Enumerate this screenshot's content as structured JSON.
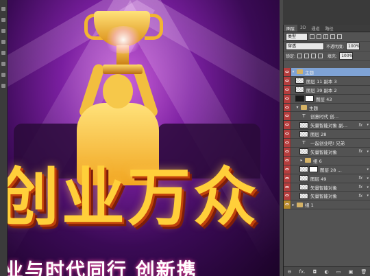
{
  "canvas": {
    "headline": "创业万众",
    "subline": "业与时代同行 创新携"
  },
  "panel": {
    "tabs": [
      "图层",
      "3D",
      "通道",
      "路径"
    ],
    "active_tab": "图层",
    "filter_label": "类型",
    "blend_mode": "穿透",
    "opacity_label": "不透明度:",
    "opacity_value": "100%",
    "lock_label": "锁定:",
    "fill_label": "填充:",
    "fill_value": "100%",
    "layers": [
      {
        "name": "主题",
        "kind": "group-open",
        "selected": true
      },
      {
        "name": "图层 11 副本 3",
        "kind": "layer"
      },
      {
        "name": "图层 39 副本 2",
        "kind": "layer"
      },
      {
        "name": "图层 43",
        "kind": "layer-mask"
      },
      {
        "name": "主题",
        "kind": "group-open-sub"
      },
      {
        "name": "创意时代 创…",
        "kind": "text"
      },
      {
        "name": "矢量智能对象 副…",
        "kind": "smart",
        "fx": "fx"
      },
      {
        "name": "图层 28",
        "kind": "layer"
      },
      {
        "name": "一起创业吧! 兄弟",
        "kind": "text"
      },
      {
        "name": "矢量智能对象",
        "kind": "smart",
        "fx": "fx"
      },
      {
        "name": "组 6",
        "kind": "group-closed"
      },
      {
        "name": "图层 28 …",
        "kind": "layer-mask"
      },
      {
        "name": "图层 49",
        "kind": "layer",
        "fx": "fx"
      },
      {
        "name": "矢量智能对象",
        "kind": "smart",
        "fx": "fx"
      },
      {
        "name": "矢量智能对象",
        "kind": "smart",
        "fx": "fx"
      },
      {
        "name": "组 1",
        "kind": "group-closed-root"
      }
    ],
    "footer_icons": [
      "link-icon",
      "fx-icon",
      "mask-icon",
      "adjustment-icon",
      "folder-icon",
      "new-layer-icon",
      "trash-icon"
    ],
    "footer_glyphs": [
      "⊖",
      "fx.",
      "◘",
      "◐",
      "▭",
      "▣",
      "🗑"
    ],
    "fx_label": "fx",
    "colors": {
      "eye_on": "#b53d3d",
      "selected_row": "#7fa3d6",
      "panel_bg": "#535353"
    }
  }
}
